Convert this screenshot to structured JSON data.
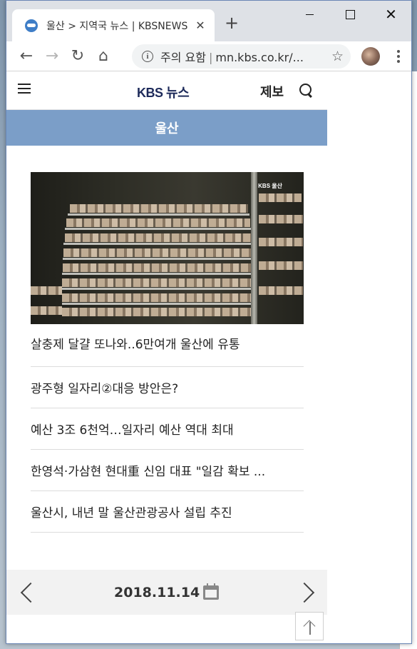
{
  "browser": {
    "tab_title": "울산 > 지역국 뉴스 | KBSNEWS",
    "omnibox": {
      "security_label": "주의 요함",
      "url": "mn.kbs.co.kr/..."
    },
    "icons": {
      "back": "back-arrow-icon",
      "forward": "forward-arrow-icon",
      "reload": "reload-icon",
      "home": "home-icon",
      "info": "info-icon",
      "star": "bookmark-star-icon"
    }
  },
  "site": {
    "logo": "KBS 뉴스",
    "report_label": "제보",
    "region": "울산"
  },
  "news": {
    "headline": "살충제 달걀 또나와..6만여개 울산에 유통",
    "image_watermark": "KBS 울산",
    "items": [
      "광주형 일자리②대응 방안은?",
      "예산 3조 6천억…일자리 예산 역대 최대",
      "한영석·가삼현 현대重 신임 대표 \"일감 확보 ...",
      "울산시, 내년 말 울산관광공사 설립 추진"
    ]
  },
  "date_nav": {
    "date": "2018.11.14"
  },
  "colors": {
    "region_bar": "#7b9ec8",
    "logo": "#1d2a5a",
    "date_bar": "#f2f2f2"
  }
}
